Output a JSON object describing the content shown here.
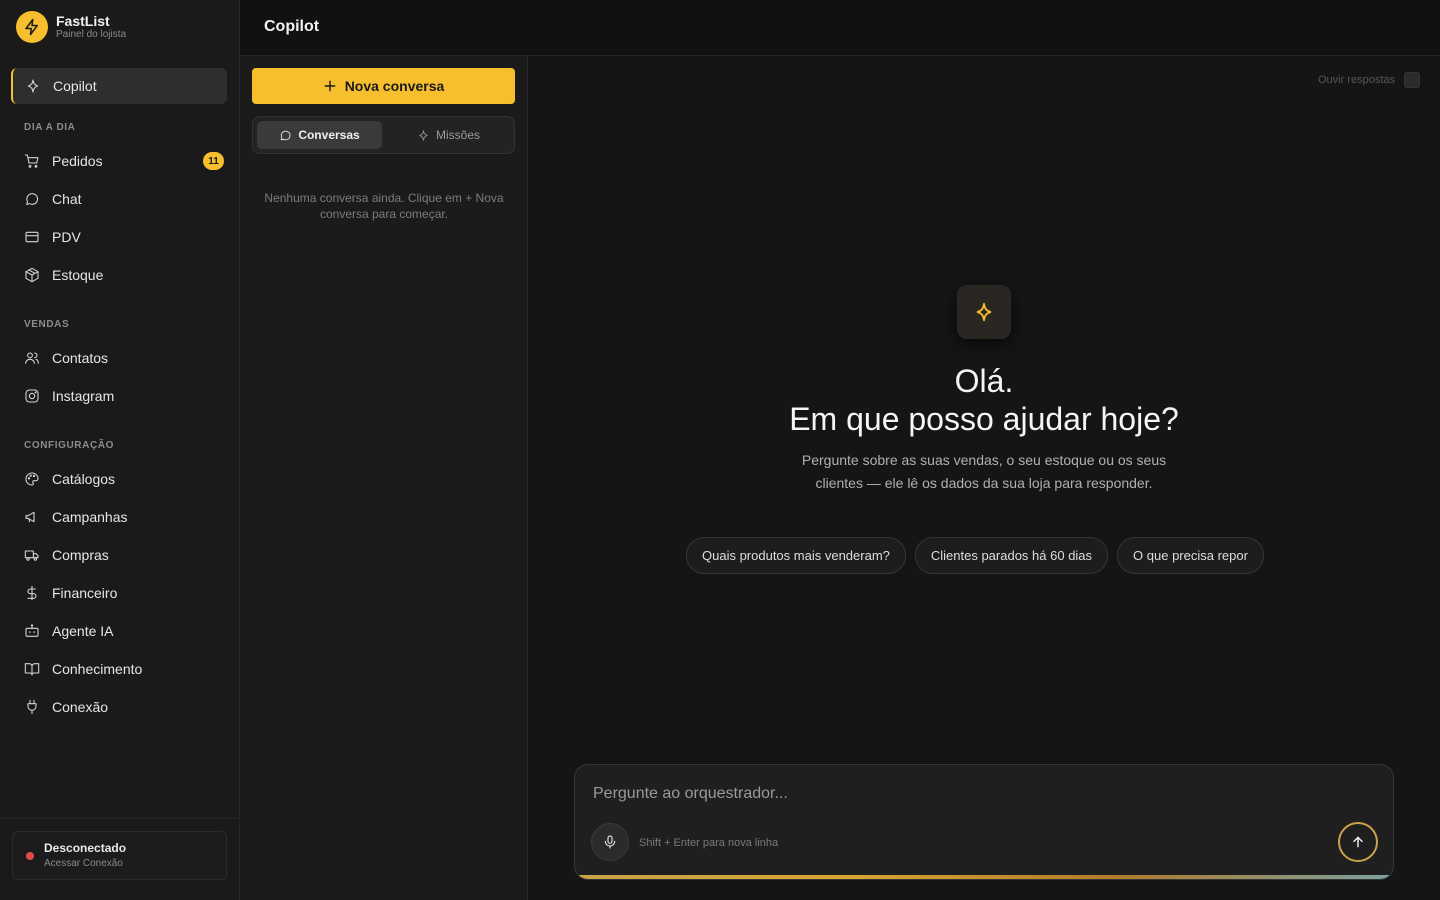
{
  "brand": {
    "name": "FastList",
    "subtitle": "Painel do lojista"
  },
  "sidebar": {
    "active_item": {
      "label": "Copilot",
      "icon": "sparkle-icon"
    },
    "sections": [
      {
        "title": "DIA A DIA",
        "items": [
          {
            "label": "Pedidos",
            "icon": "cart-icon",
            "badge": "11"
          },
          {
            "label": "Chat",
            "icon": "message-icon"
          },
          {
            "label": "PDV",
            "icon": "card-icon"
          },
          {
            "label": "Estoque",
            "icon": "box-icon"
          }
        ]
      },
      {
        "title": "VENDAS",
        "items": [
          {
            "label": "Contatos",
            "icon": "users-icon"
          },
          {
            "label": "Instagram",
            "icon": "instagram-icon"
          }
        ]
      },
      {
        "title": "CONFIGURAÇÃO",
        "items": [
          {
            "label": "Catálogos",
            "icon": "palette-icon"
          },
          {
            "label": "Campanhas",
            "icon": "megaphone-icon"
          },
          {
            "label": "Compras",
            "icon": "truck-icon"
          },
          {
            "label": "Financeiro",
            "icon": "dollar-icon"
          },
          {
            "label": "Agente IA",
            "icon": "bot-icon"
          },
          {
            "label": "Conhecimento",
            "icon": "book-icon"
          },
          {
            "label": "Conexão",
            "icon": "plug-icon"
          }
        ]
      }
    ],
    "status": {
      "title": "Desconectado",
      "subtitle": "Acessar Conexão",
      "color": "#e5484d"
    }
  },
  "topbar": {
    "title": "Copilot"
  },
  "conversations": {
    "new_button": "Nova conversa",
    "tabs": [
      {
        "label": "Conversas",
        "active": true
      },
      {
        "label": "Missões",
        "active": false
      }
    ],
    "empty_text": "Nenhuma conversa ainda. Clique em + Nova conversa para começar."
  },
  "main": {
    "listen_label": "Ouvir respostas",
    "greeting_line1": "Olá.",
    "greeting_line2": "Em que posso ajudar hoje?",
    "subtitle": "Pergunte sobre as suas vendas, o seu estoque ou os seus clientes — ele lê os dados da sua loja para responder.",
    "suggestions": [
      "Quais produtos mais venderam?",
      "Clientes parados há 60 dias",
      "O que precisa repor"
    ],
    "composer": {
      "placeholder": "Pergunte ao orquestrador...",
      "hint": "Shift + Enter para nova linha"
    }
  },
  "colors": {
    "accent": "#f7bf2e",
    "background": "#141414",
    "sidebar": "#1a1a1a"
  }
}
